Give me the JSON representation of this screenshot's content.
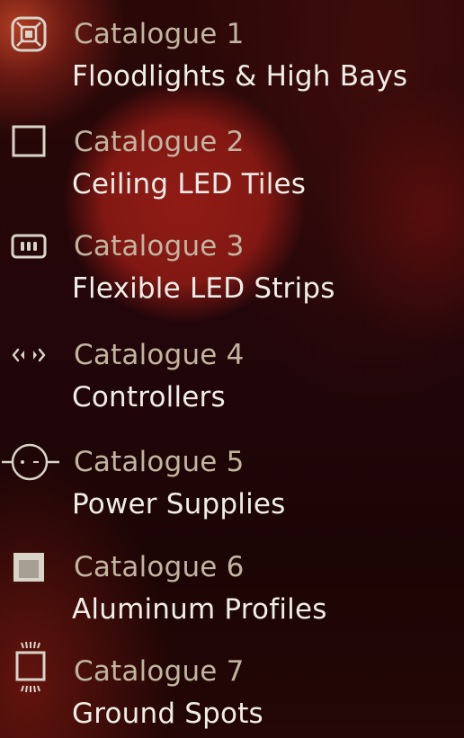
{
  "catalogues": [
    {
      "number_label": "Catalogue 1",
      "name": "Floodlights & High Bays",
      "icon": "floodlight-icon"
    },
    {
      "number_label": "Catalogue 2",
      "name": "Ceiling LED Tiles",
      "icon": "ceiling-tile-icon"
    },
    {
      "number_label": "Catalogue 3",
      "name": "Flexible LED Strips",
      "icon": "led-strip-icon"
    },
    {
      "number_label": "Catalogue 4",
      "name": "Controllers",
      "icon": "controller-icon"
    },
    {
      "number_label": "Catalogue 5",
      "name": "Power Supplies",
      "icon": "power-supply-icon"
    },
    {
      "number_label": "Catalogue 6",
      "name": "Aluminum Profiles",
      "icon": "aluminum-profile-icon"
    },
    {
      "number_label": "Catalogue 7",
      "name": "Ground Spots",
      "icon": "ground-spot-icon"
    }
  ],
  "colors": {
    "number_text": "#c2b59f",
    "name_text": "#f0ede6",
    "icon": "#d9d4c8",
    "background": "#22060a"
  }
}
